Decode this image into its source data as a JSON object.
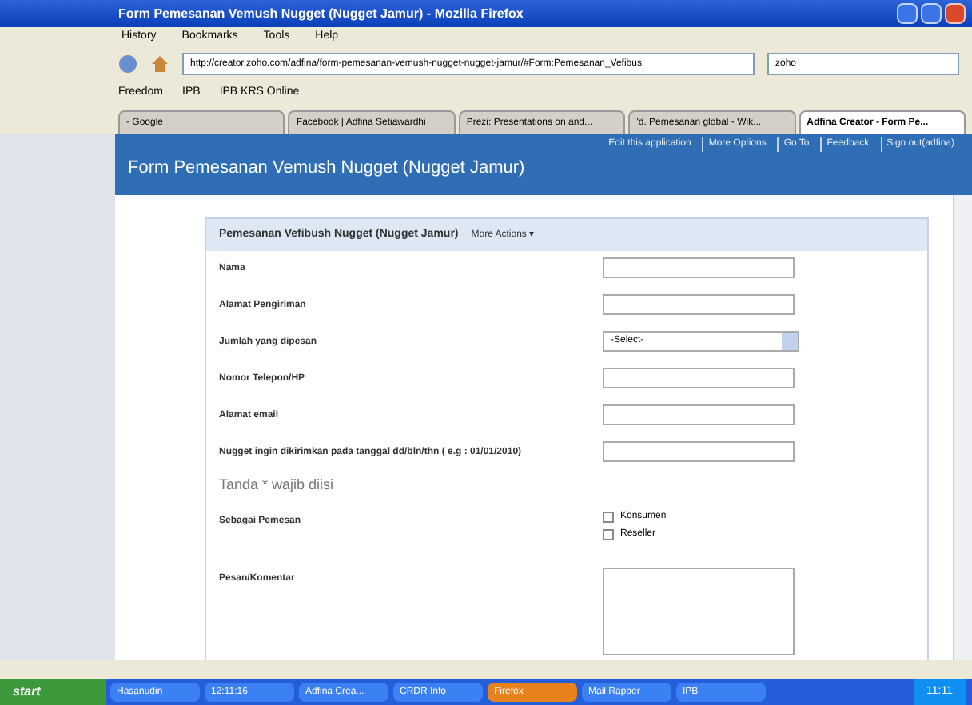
{
  "window": {
    "title": "Form Pemesanan Vemush Nugget (Nugget Jamur) - Mozilla Firefox"
  },
  "menu": [
    "History",
    "Bookmarks",
    "Tools",
    "Help"
  ],
  "address_bar": {
    "value": "http://creator.zoho.com/adfina/form-pemesanan-vemush-nugget-nugget-jamur/#Form:Pemesanan_Vefibus"
  },
  "search": {
    "value": "zoho"
  },
  "bookmarks": [
    "Freedom",
    "IPB",
    "IPB KRS Online"
  ],
  "tabs": [
    {
      "label": "- Google",
      "selected": false
    },
    {
      "label": "Facebook | Adfina Setiawardhi",
      "selected": false
    },
    {
      "label": "Prezi: Presentations on and...",
      "selected": false
    },
    {
      "label": "'d. Pemesanan global - Wik...",
      "selected": false
    },
    {
      "label": "Adfina Creator - Form Pe...",
      "selected": true
    }
  ],
  "app_header": {
    "title": "Form Pemesanan Vemush Nugget (Nugget Jamur)",
    "links": [
      "Edit this application",
      "More Options",
      "Go To",
      "Feedback",
      "Sign out(adfina)"
    ]
  },
  "form": {
    "title": "Pemesanan Vefibush Nugget (Nugget Jamur)",
    "actions": "More Actions ▾",
    "fields": [
      {
        "kind": "text",
        "label": "Nama"
      },
      {
        "kind": "text",
        "label": "Alamat Pengiriman"
      },
      {
        "kind": "select",
        "label": "Jumlah yang dipesan",
        "value": "-Select-"
      },
      {
        "kind": "text",
        "label": "Nomor Telepon/HP"
      },
      {
        "kind": "text",
        "label": "Alamat email"
      },
      {
        "kind": "text",
        "label": "Nugget ingin dikirimkan pada tanggal dd/bln/thn ( e.g : 01/01/2010)"
      },
      {
        "kind": "note",
        "label": "Tanda * wajib diisi"
      },
      {
        "kind": "checks",
        "label": "Sebagai Pemesan",
        "options": [
          {
            "label": "Konsumen",
            "checked": false
          },
          {
            "label": "Reseller",
            "checked": false
          }
        ]
      },
      {
        "kind": "textarea",
        "label": "Pesan/Komentar"
      }
    ]
  },
  "taskbar": {
    "start": "start",
    "items": [
      {
        "label": "Hasanudin",
        "selected": false
      },
      {
        "label": "12:11:16",
        "selected": false
      },
      {
        "label": "Adfina Crea...",
        "selected": false
      },
      {
        "label": "CRDR Info",
        "selected": false
      },
      {
        "label": "Firefox",
        "selected": true
      },
      {
        "label": "Mail Rapper",
        "selected": false
      },
      {
        "label": "IPB",
        "selected": false
      }
    ],
    "clock": "11:11"
  }
}
